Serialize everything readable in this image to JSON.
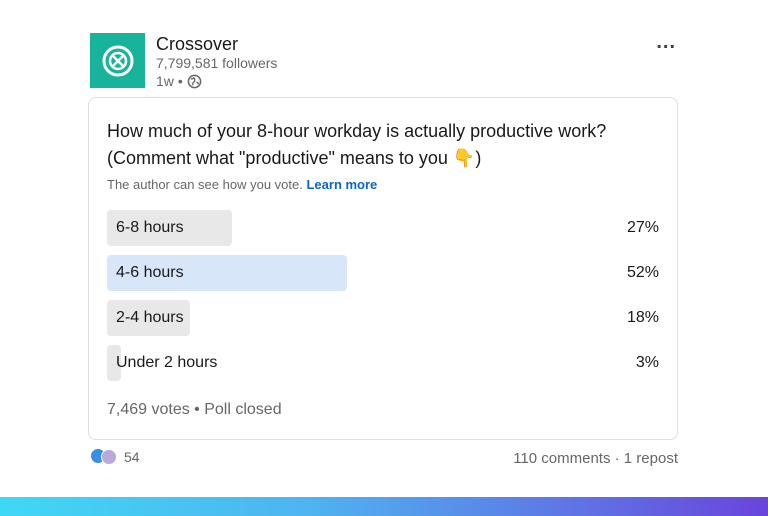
{
  "post": {
    "company": "Crossover",
    "followers": "7,799,581 followers",
    "age": "1w",
    "separator": "•",
    "more_icon": "..."
  },
  "poll": {
    "question": "How much of your 8-hour workday is actually productive work? (Comment what \"productive\" means to you 👇)",
    "privacy_note": "The author can see how you vote.",
    "learn_more": "Learn more",
    "options": [
      {
        "label": "6-8 hours",
        "percent": "27%",
        "fraction": 0.27,
        "selected": false
      },
      {
        "label": "4-6 hours",
        "percent": "52%",
        "fraction": 0.52,
        "selected": true
      },
      {
        "label": "2-4 hours",
        "percent": "18%",
        "fraction": 0.18,
        "selected": false
      },
      {
        "label": "Under 2 hours",
        "percent": "3%",
        "fraction": 0.03,
        "selected": false
      }
    ],
    "votes_summary": "7,469 votes • Poll closed"
  },
  "footer": {
    "reaction_count": "54",
    "comments": "110 comments",
    "dot": "·",
    "reposts": "1 repost"
  },
  "colors": {
    "logo_bg": "#17b39b",
    "bar_default": "#e8e8e8",
    "bar_selected": "#d7e6f8",
    "link": "#0a66c2"
  }
}
